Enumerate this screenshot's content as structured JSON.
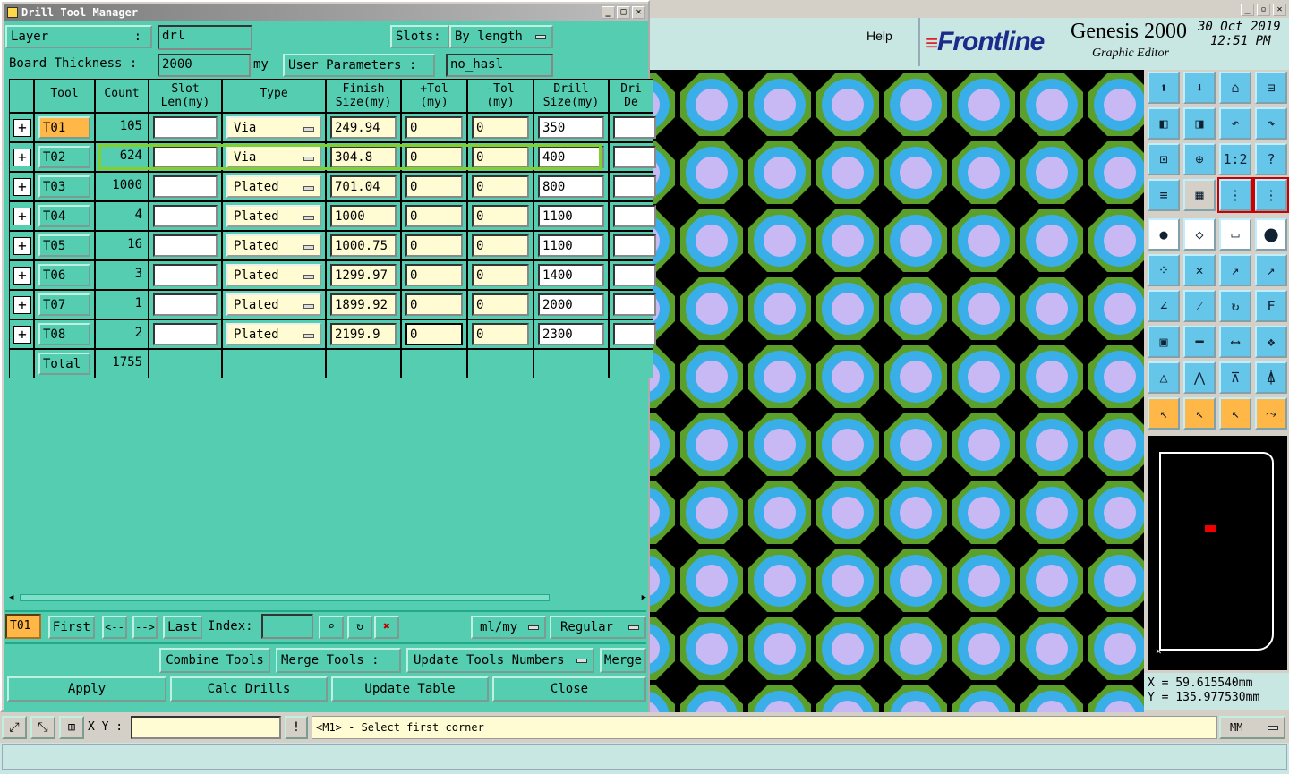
{
  "dialog": {
    "title": "Drill Tool Manager",
    "layer_label": "Layer",
    "layer_colon": ":",
    "layer_value": "drl",
    "slots_label": "Slots:",
    "slots_value": "By length",
    "thickness_label": "Board Thickness :",
    "thickness_value": "2000",
    "thickness_unit": "my",
    "user_params_label": "User Parameters :",
    "user_params_value": "no_hasl"
  },
  "table": {
    "headers": [
      "Tool",
      "Count",
      "Slot\nLen(my)",
      "Type",
      "Finish\nSize(my)",
      "+Tol\n(my)",
      "-Tol\n(my)",
      "Drill\nSize(my)",
      "Dri\nDe"
    ],
    "rows": [
      {
        "tool": "T01",
        "count": "105",
        "type": "Via",
        "finish": "249.94",
        "ptol": "0",
        "ntol": "0",
        "drill": "350"
      },
      {
        "tool": "T02",
        "count": "624",
        "type": "Via",
        "finish": "304.8",
        "ptol": "0",
        "ntol": "0",
        "drill": "400"
      },
      {
        "tool": "T03",
        "count": "1000",
        "type": "Plated",
        "finish": "701.04",
        "ptol": "0",
        "ntol": "0",
        "drill": "800"
      },
      {
        "tool": "T04",
        "count": "4",
        "type": "Plated",
        "finish": "1000",
        "ptol": "0",
        "ntol": "0",
        "drill": "1100"
      },
      {
        "tool": "T05",
        "count": "16",
        "type": "Plated",
        "finish": "1000.75",
        "ptol": "0",
        "ntol": "0",
        "drill": "1100"
      },
      {
        "tool": "T06",
        "count": "3",
        "type": "Plated",
        "finish": "1299.97",
        "ptol": "0",
        "ntol": "0",
        "drill": "1400"
      },
      {
        "tool": "T07",
        "count": "1",
        "type": "Plated",
        "finish": "1899.92",
        "ptol": "0",
        "ntol": "0",
        "drill": "2000"
      },
      {
        "tool": "T08",
        "count": "2",
        "type": "Plated",
        "finish": "2199.9",
        "ptol": "0",
        "ntol": "0",
        "drill": "2300"
      }
    ],
    "total_label": "Total",
    "total_count": "1755"
  },
  "nav": {
    "current_tool": "T01",
    "first": "First",
    "prev": "<--",
    "next": "-->",
    "last": "Last",
    "index_label": "Index:",
    "units": "ml/my",
    "mode": "Regular"
  },
  "actions": {
    "combine": "Combine Tools",
    "merge_label": "Merge Tools :",
    "merge_select": "Update Tools Numbers",
    "merge": "Merge",
    "apply": "Apply",
    "calc": "Calc Drills",
    "update": "Update Table",
    "close": "Close"
  },
  "header": {
    "help": "Help",
    "brand": "Frontline",
    "product": "Genesis 2000",
    "subtitle": "Graphic Editor",
    "date": "30 Oct 2019",
    "time": "12:51 PM"
  },
  "coords": {
    "x": "X  =  59.615540mm",
    "y": "Y  = 135.977530mm"
  },
  "cmdbar": {
    "xy_label": "X Y :",
    "prompt": "<M1> - Select first corner",
    "units": "MM"
  },
  "colors": {
    "dialog_teal": "#55cdb0",
    "editor_header": "#c9e7e2",
    "pad_ring": "#3aaee8",
    "pad_hole": "#c8b8f4",
    "pad_outer": "#5aa02a",
    "selected_tool": "#ffb848",
    "highlight_row": "#7fd030",
    "brand_red": "#e0202a",
    "brand_blue": "#1c2a8c"
  }
}
